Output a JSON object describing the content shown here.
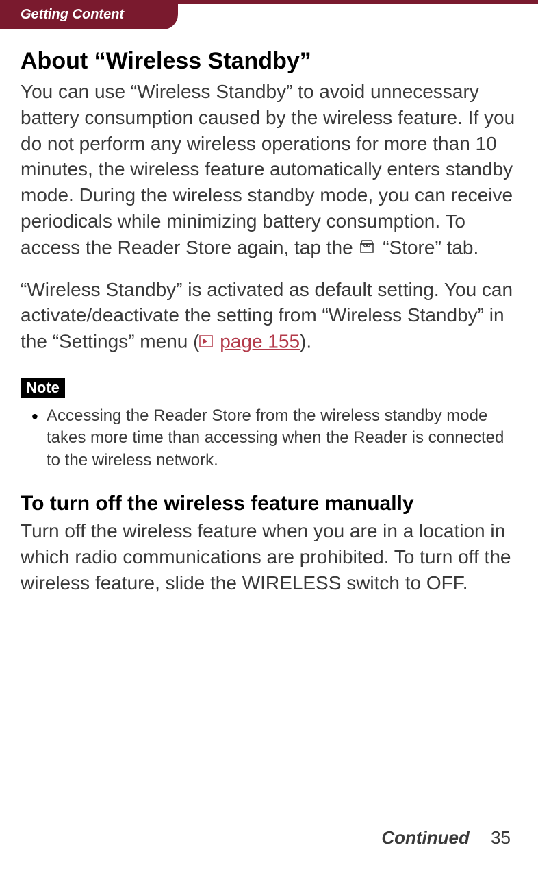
{
  "header": {
    "section": "Getting Content"
  },
  "heading1": "About “Wireless Standby”",
  "para1_a": "You can use “Wireless Standby” to avoid unnecessary battery consumption caused by the wireless feature. If you do not perform any wireless operations for more than 10 minutes, the wireless feature automatically enters standby mode. During the wireless standby mode, you can receive periodicals while minimizing battery consumption. To access the Reader Store again, tap the ",
  "para1_b": " “Store” tab.",
  "para2_a": "“Wireless Standby” is activated as default setting. You can activate/deactivate the setting from “Wireless Standby” in the “Settings” menu (",
  "para2_link": "page 155",
  "para2_b": ").",
  "note_label": "Note",
  "note_item": "Accessing the Reader Store from the wireless standby mode takes more time than accessing when the Reader is connected to the wireless network.",
  "heading2": "To turn off the wireless feature manually",
  "para3": "Turn off the wireless feature when you are in a location in which radio communications are prohibited. To turn off the wireless feature, slide the WIRELESS switch to OFF.",
  "footer": {
    "continued": "Continued",
    "page": "35"
  }
}
